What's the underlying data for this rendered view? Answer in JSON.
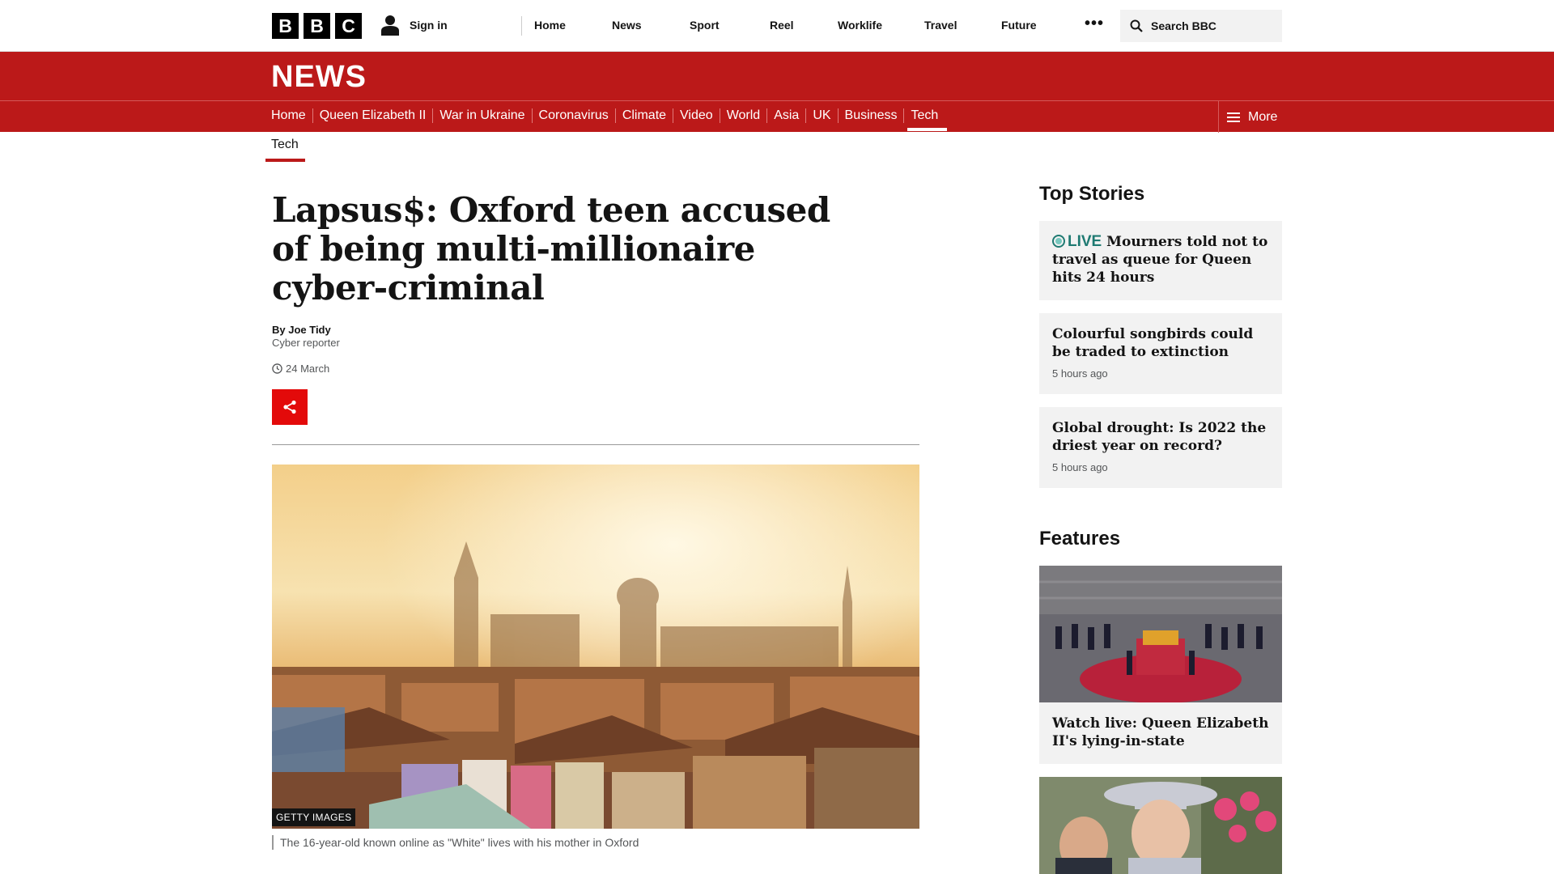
{
  "brand": {
    "letters": [
      "B",
      "B",
      "C"
    ]
  },
  "account": {
    "signin_label": "Sign in"
  },
  "top_nav": [
    "Home",
    "News",
    "Sport",
    "Reel",
    "Worklife",
    "Travel",
    "Future"
  ],
  "search": {
    "placeholder": "Search BBC"
  },
  "news_banner": {
    "title": "NEWS"
  },
  "section_nav": {
    "items": [
      "Home",
      "Queen Elizabeth II",
      "War in Ukraine",
      "Coronavirus",
      "Climate",
      "Video",
      "World",
      "Asia",
      "UK",
      "Business",
      "Tech"
    ],
    "active": "Tech",
    "more_label": "More"
  },
  "subsection": {
    "label": "Tech"
  },
  "article": {
    "headline": "Lapsus$: Oxford teen accused of being multi-millionaire cyber-criminal",
    "byline": "By Joe Tidy",
    "role": "Cyber reporter",
    "date": "24 March",
    "image_credit": "GETTY IMAGES",
    "caption": "The 16-year-old known online as \"White\" lives with his mother in Oxford"
  },
  "top_stories": {
    "heading": "Top Stories",
    "items": [
      {
        "live_label": "LIVE",
        "title": "Mourners told not to travel as queue for Queen hits 24 hours",
        "ago": ""
      },
      {
        "live_label": "",
        "title": "Colourful songbirds could be traded to extinction",
        "ago": "5 hours ago"
      },
      {
        "live_label": "",
        "title": "Global drought: Is 2022 the driest year on record?",
        "ago": "5 hours ago"
      }
    ]
  },
  "features": {
    "heading": "Features",
    "items": [
      {
        "title": "Watch live: Queen Elizabeth II's lying-in-state"
      }
    ]
  },
  "colors": {
    "news_red": "#bb1919",
    "share_red": "#e30a0a",
    "live_teal": "#1f7a72"
  }
}
